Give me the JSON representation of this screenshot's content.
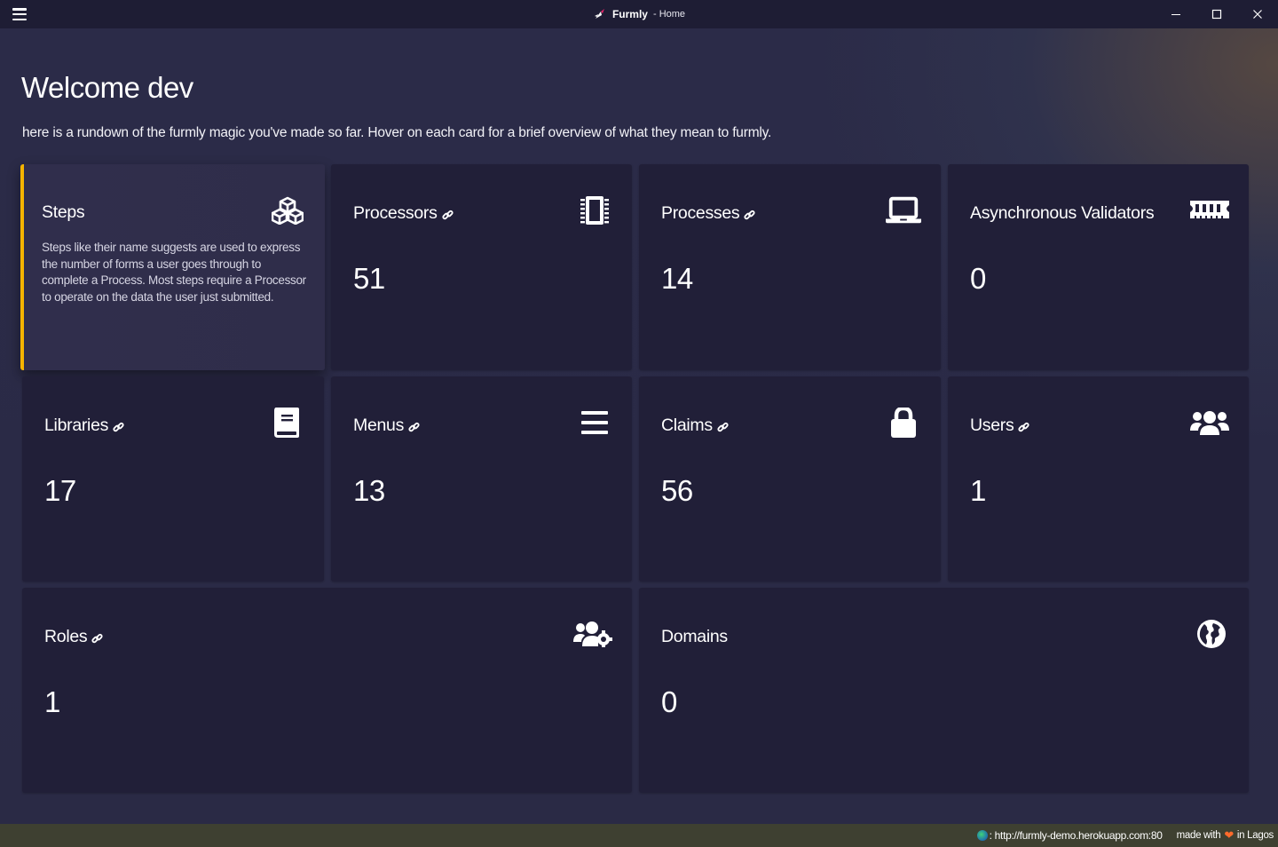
{
  "titlebar": {
    "app_name": "Furmly",
    "page": "- Home"
  },
  "main": {
    "welcome": "Welcome dev",
    "intro": "here is a rundown of the furmly magic you've made so far. Hover on each card for a brief overview of what they mean to furmly."
  },
  "cards": [
    {
      "title": "Steps",
      "description": "Steps like their name suggests are used to express the number of forms a user goes through to complete a Process. Most steps require a Processor to operate on the data the user just submitted.",
      "icon": "cubes-icon",
      "linked": false,
      "active": true
    },
    {
      "title": "Processors",
      "value": "51",
      "icon": "microchip-icon",
      "linked": true
    },
    {
      "title": "Processes",
      "value": "14",
      "icon": "laptop-icon",
      "linked": true
    },
    {
      "title": "Asynchronous Validators",
      "value": "0",
      "icon": "memory-icon",
      "linked": false
    },
    {
      "title": "Libraries",
      "value": "17",
      "icon": "book-icon",
      "linked": true
    },
    {
      "title": "Menus",
      "value": "13",
      "icon": "bars-icon",
      "linked": true
    },
    {
      "title": "Claims",
      "value": "56",
      "icon": "lock-icon",
      "linked": true
    },
    {
      "title": "Users",
      "value": "1",
      "icon": "users-icon",
      "linked": true
    },
    {
      "title": "Roles",
      "value": "1",
      "icon": "users-cog-icon",
      "linked": true
    },
    {
      "title": "Domains",
      "value": "0",
      "icon": "globe-icon",
      "linked": false
    }
  ],
  "statusbar": {
    "url": ": http://furmly-demo.herokuapp.com:80",
    "made_with": "made with",
    "location": "in Lagos"
  },
  "colors": {
    "background": "#2a2a46",
    "card": "#211f38",
    "active_accent": "#f5b400",
    "titlebar": "#1e1d34",
    "statusbar": "#3e4031"
  }
}
